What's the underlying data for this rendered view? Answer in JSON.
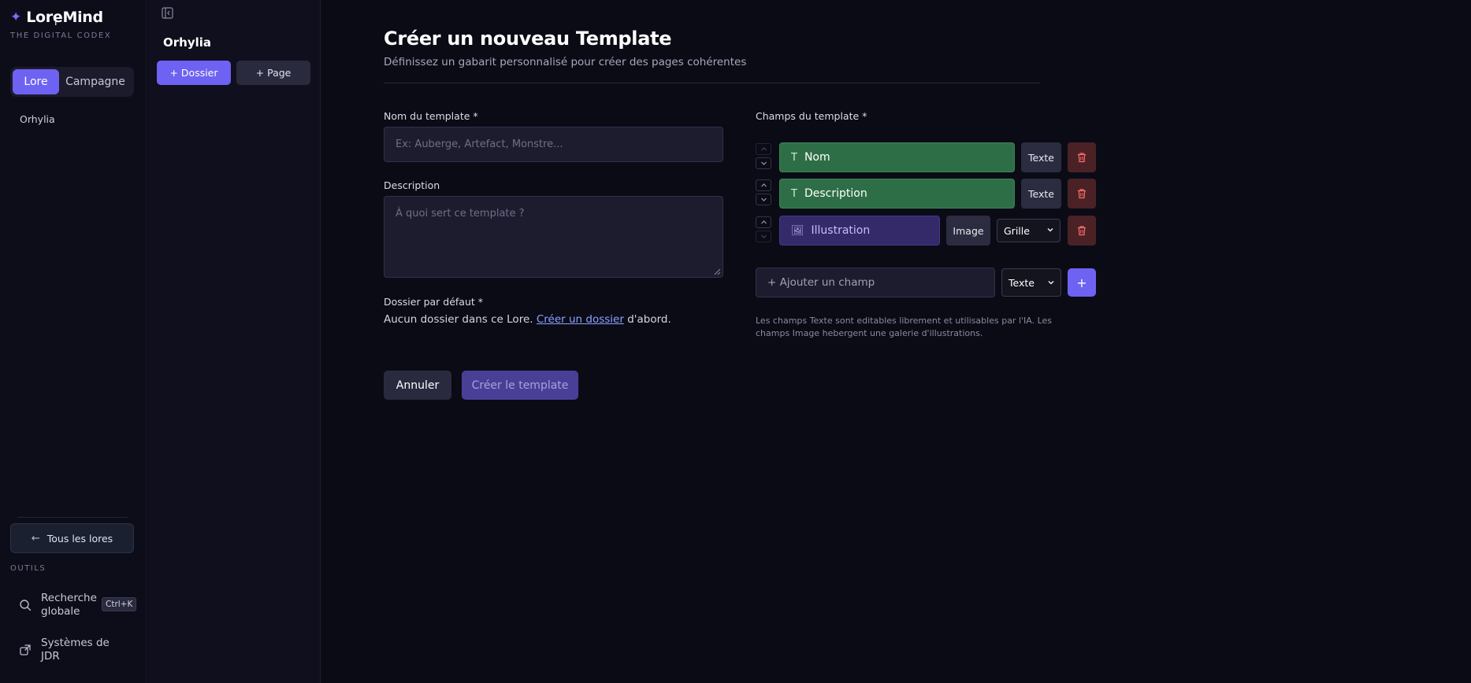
{
  "app": {
    "name": "LoreMind",
    "tagline": "THE DIGITAL CODEX",
    "logo_icon": "sparkle-icon",
    "accent": "#6e62f2"
  },
  "sidebar": {
    "tabs": [
      {
        "label": "Lore",
        "active": true
      },
      {
        "label": "Campagne",
        "active": false
      }
    ],
    "lores": [
      "Orhylia"
    ],
    "back_button": "Tous les lores",
    "tools_label": "OUTILS",
    "tools": [
      {
        "label_line1": "Recherche",
        "label_line2": "globale",
        "icon": "search-icon",
        "shortcut": "Ctrl+K"
      },
      {
        "label_line1": "Systèmes de",
        "label_line2": "JDR",
        "icon": "external-link-icon"
      }
    ]
  },
  "panel": {
    "title": "Orhylia",
    "add_folder": "+ Dossier",
    "add_page": "+ Page"
  },
  "main": {
    "title": "Créer un nouveau Template",
    "subtitle": "Définissez un gabarit personnalisé pour créer des pages cohérentes",
    "name_label": "Nom du template *",
    "name_placeholder": "Ex: Auberge, Artefact, Monstre...",
    "description_label": "Description",
    "description_placeholder": "À quoi sert ce template ?",
    "folder_label": "Dossier par défaut *",
    "folder_text_before": "Aucun dossier dans ce Lore.",
    "folder_link": "Créer un dossier",
    "folder_text_after": "d'abord.",
    "cancel": "Annuler",
    "create": "Créer le template",
    "fields_label": "Champs du template *",
    "fields": [
      {
        "name": "Nom",
        "type": "Texte",
        "icon": "text-t-icon",
        "color": "#2e6e47"
      },
      {
        "name": "Description",
        "type": "Texte",
        "icon": "text-t-icon",
        "color": "#2e6e47"
      },
      {
        "name": "Illustration",
        "type": "Image",
        "icon": "image-icon",
        "layout": "Grille",
        "color": "#342a6a"
      }
    ],
    "add_field_placeholder": "+ Ajouter un champ",
    "add_field_type": "Texte",
    "add_field_button": "+",
    "help_text": "Les champs Texte sont editables librement et utilisables par l'IA. Les champs Image hebergent une galerie d'illustrations."
  }
}
